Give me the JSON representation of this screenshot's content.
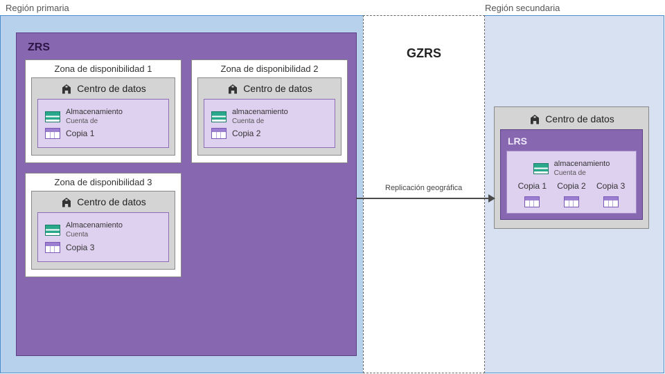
{
  "regions": {
    "primary_label": "Región primaria",
    "secondary_label": "Región secundaria"
  },
  "gzrs": {
    "title": "GZRS"
  },
  "arrow": {
    "label": "Replicación geográfica"
  },
  "zrs": {
    "title": "ZRS",
    "zones": [
      {
        "title": "Zona de disponibilidad 1",
        "datacenter_label": "Centro de datos",
        "storage_line1": "Almacenamiento",
        "storage_line2": "Cuenta de",
        "copy_label": "Copia 1"
      },
      {
        "title": "Zona de disponibilidad 2",
        "datacenter_label": "Centro de datos",
        "storage_line1": "almacenamiento",
        "storage_line2": "Cuenta de",
        "copy_label": "Copia 2"
      },
      {
        "title": "Zona de disponibilidad 3",
        "datacenter_label": "Centro de datos",
        "storage_line1": "Almacenamiento",
        "storage_line2": "Cuenta",
        "copy_label": "Copia 3"
      }
    ]
  },
  "secondary_dc": {
    "datacenter_label": "Centro de datos",
    "lrs_title": "LRS",
    "storage_line1": "almacenamiento",
    "storage_line2": "Cuenta de",
    "copies": [
      "Copia 1",
      "Copia 2",
      "Copia 3"
    ]
  },
  "icons": {
    "datacenter": "datacenter-building-icon",
    "storage_account": "storage-account-icon",
    "data_copy": "data-copy-icon"
  }
}
